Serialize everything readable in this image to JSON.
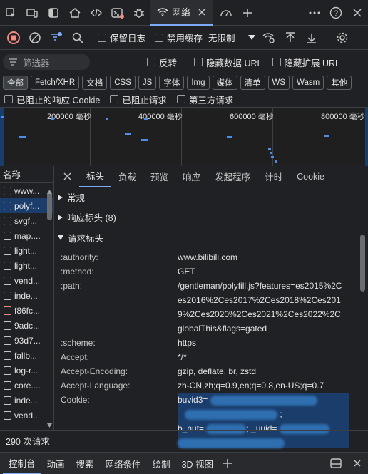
{
  "tabs": {
    "network_label": "网络"
  },
  "toolbar": {
    "preserve_log": "保留日志",
    "disable_cache": "禁用缓存",
    "throttle": "无限制"
  },
  "filter": {
    "placeholder": "筛选器",
    "invert": "反转",
    "hide_data_url": "隐藏数据 URL",
    "hide_ext_url": "隐藏扩展 URL"
  },
  "types": [
    "全部",
    "Fetch/XHR",
    "文档",
    "CSS",
    "JS",
    "字体",
    "Img",
    "媒体",
    "清单",
    "WS",
    "Wasm",
    "其他"
  ],
  "blocked": {
    "blocked_cookies": "已阻止的响应 Cookie",
    "blocked_requests": "已阻止请求",
    "third_party": "第三方请求"
  },
  "timeline": {
    "ticks": [
      "200000 毫秒",
      "400000 毫秒",
      "600000 毫秒",
      "800000 毫秒"
    ]
  },
  "list": {
    "header": "名称",
    "items": [
      "www...",
      "polyf...",
      "svgf...",
      "map....",
      "light...",
      "light...",
      "vend...",
      "inde...",
      "f86fc...",
      "9adc...",
      "93d7...",
      "fallb...",
      "log-r...",
      "core....",
      "inde...",
      "vend..."
    ]
  },
  "detail": {
    "tabs": [
      "标头",
      "负载",
      "预览",
      "响应",
      "发起程序",
      "计时",
      "Cookie"
    ],
    "general": "常规",
    "response_headers": "响应标头 (8)",
    "request_headers": "请求标头",
    "headers": [
      {
        "k": ":authority:",
        "v": "www.bilibili.com"
      },
      {
        "k": ":method:",
        "v": "GET"
      },
      {
        "k": ":path:",
        "v": "/gentleman/polyfill.js?features=es2015%2Ces2016%2Ces2017%2Ces2018%2Ces2019%2Ces2020%2Ces2021%2Ces2022%2CglobalThis&flags=gated"
      },
      {
        "k": ":scheme:",
        "v": "https"
      },
      {
        "k": "Accept:",
        "v": "*/*"
      },
      {
        "k": "Accept-Encoding:",
        "v": "gzip, deflate, br, zstd"
      },
      {
        "k": "Accept-Language:",
        "v": "zh-CN,zh;q=0.9,en;q=0.8,en-US;q=0.7"
      },
      {
        "k": "Cookie:",
        "v": "buvid3="
      }
    ],
    "cookie_frag_2": "b_nut=",
    "cookie_frag_3": "; _uuid="
  },
  "status": {
    "requests": "290 次请求"
  },
  "drawer": {
    "tabs": [
      "控制台",
      "动画",
      "搜索",
      "网络条件",
      "绘制",
      "3D 视图"
    ]
  },
  "colors": {
    "accent": "#7cacf8",
    "record": "#f28b82",
    "selection": "#1b3d6b"
  }
}
